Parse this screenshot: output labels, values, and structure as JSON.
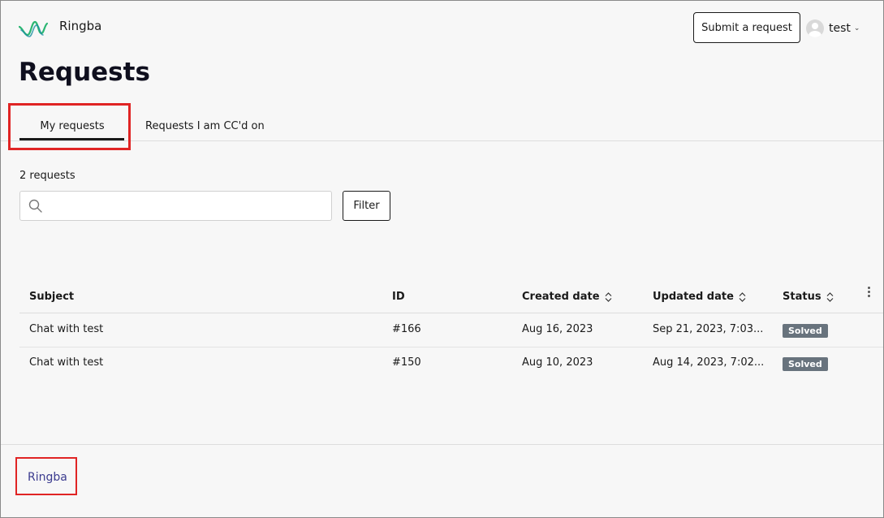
{
  "header": {
    "brand": "Ringba",
    "submit_label": "Submit a request",
    "username": "test"
  },
  "page": {
    "title": "Requests",
    "tabs": [
      {
        "label": "My requests",
        "active": true
      },
      {
        "label": "Requests I am CC'd on",
        "active": false
      }
    ],
    "count_text": "2 requests",
    "search": {
      "value": "",
      "placeholder": ""
    },
    "filter_label": "Filter"
  },
  "table": {
    "columns": [
      "Subject",
      "ID",
      "Created date",
      "Updated date",
      "Status"
    ],
    "rows": [
      {
        "subject": "Chat with test",
        "id": "#166",
        "created": "Aug 16, 2023",
        "updated": "Sep 21, 2023, 7:03...",
        "status": "Solved"
      },
      {
        "subject": "Chat with test",
        "id": "#150",
        "created": "Aug 10, 2023",
        "updated": "Aug 14, 2023, 7:02...",
        "status": "Solved"
      }
    ]
  },
  "footer": {
    "link": "Ringba"
  },
  "colors": {
    "highlight": "#e02424",
    "status_badge": "#68737d",
    "logo_green": "#2bb673",
    "logo_teal": "#1a8fa0"
  },
  "icons": [
    "ringba-logo-icon",
    "avatar-icon",
    "chevron-down-icon",
    "search-icon",
    "sort-icon",
    "kebab-menu-icon"
  ]
}
